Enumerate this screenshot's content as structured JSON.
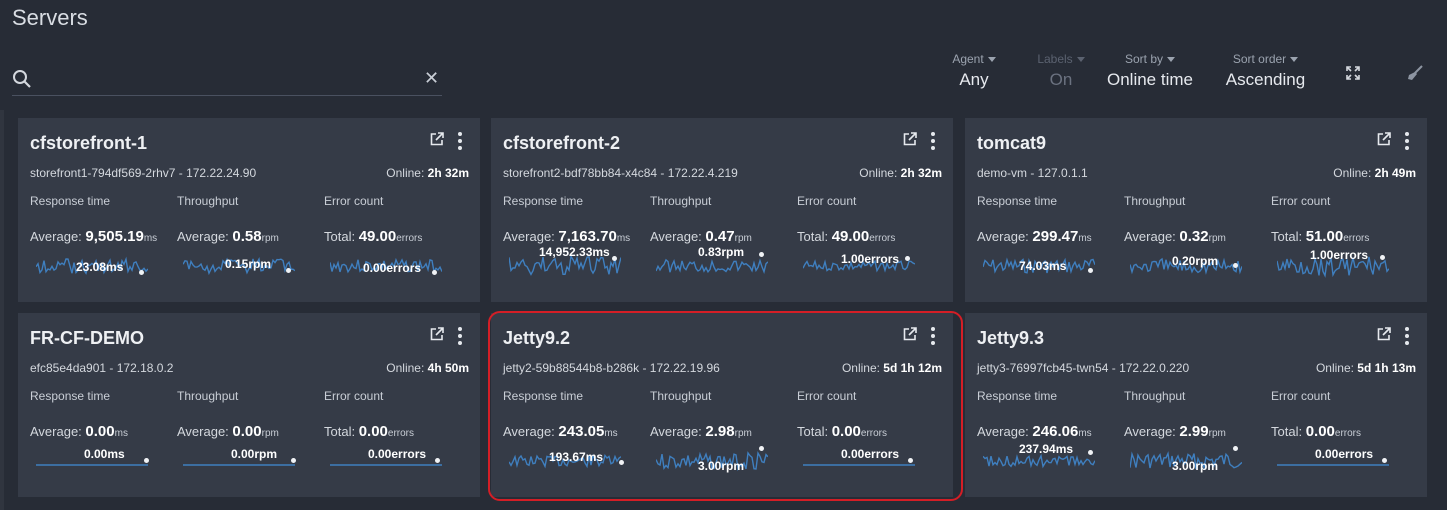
{
  "page": {
    "title": "Servers"
  },
  "search": {
    "value": "",
    "placeholder": ""
  },
  "filters": [
    {
      "label": "Agent",
      "value": "Any"
    },
    {
      "label": "Labels",
      "value": "On"
    },
    {
      "label": "Sort by",
      "value": "Online time"
    },
    {
      "label": "Sort order",
      "value": "Ascending"
    }
  ],
  "metric_headers": {
    "response": "Response time",
    "throughput": "Throughput",
    "errors": "Error count"
  },
  "metric_prefixes": {
    "response": "Average: ",
    "throughput": "Average: ",
    "errors": "Total: "
  },
  "online_prefix": "Online: ",
  "cards": [
    {
      "name": "cfstorefront-1",
      "sub": "storefront1-794df569-2rhv7 - 172.22.24.90",
      "online": "2h 32m",
      "rt_avg": "9,505.19",
      "rt_unit": "ms",
      "tp_avg": "0.58",
      "tp_unit": "rpm",
      "err_total": "49.00",
      "err_unit": "errors",
      "rt_spark": "23.08ms",
      "tp_spark": "0.15rpm",
      "err_spark": "0.00errors"
    },
    {
      "name": "cfstorefront-2",
      "sub": "storefront2-bdf78bb84-x4c84 - 172.22.4.219",
      "online": "2h 32m",
      "rt_avg": "7,163.70",
      "rt_unit": "ms",
      "tp_avg": "0.47",
      "tp_unit": "rpm",
      "err_total": "49.00",
      "err_unit": "errors",
      "rt_spark": "14,952.33ms",
      "tp_spark": "0.83rpm",
      "err_spark": "1.00errors"
    },
    {
      "name": "tomcat9",
      "sub": "demo-vm - 127.0.1.1",
      "online": "2h 49m",
      "rt_avg": "299.47",
      "rt_unit": "ms",
      "tp_avg": "0.32",
      "tp_unit": "rpm",
      "err_total": "51.00",
      "err_unit": "errors",
      "rt_spark": "74.03ms",
      "tp_spark": "0.20rpm",
      "err_spark": "1.00errors"
    },
    {
      "name": "FR-CF-DEMO",
      "sub": "efc85e4da901 - 172.18.0.2",
      "online": "4h 50m",
      "rt_avg": "0.00",
      "rt_unit": "ms",
      "tp_avg": "0.00",
      "tp_unit": "rpm",
      "err_total": "0.00",
      "err_unit": "errors",
      "rt_spark": "0.00ms",
      "tp_spark": "0.00rpm",
      "err_spark": "0.00errors"
    },
    {
      "name": "Jetty9.2",
      "sub": "jetty2-59b88544b8-b286k - 172.22.19.96",
      "online": "5d 1h 12m",
      "rt_avg": "243.05",
      "rt_unit": "ms",
      "tp_avg": "2.98",
      "tp_unit": "rpm",
      "err_total": "0.00",
      "err_unit": "errors",
      "rt_spark": "193.67ms",
      "tp_spark": "3.00rpm",
      "err_spark": "0.00errors"
    },
    {
      "name": "Jetty9.3",
      "sub": "jetty3-76997fcb45-twn54 - 172.22.0.220",
      "online": "5d 1h 13m",
      "rt_avg": "246.06",
      "rt_unit": "ms",
      "tp_avg": "2.99",
      "tp_unit": "rpm",
      "err_total": "0.00",
      "err_unit": "errors",
      "rt_spark": "237.94ms",
      "tp_spark": "3.00rpm",
      "err_spark": "0.00errors"
    }
  ],
  "colors": {
    "spark": "#3f7fbf",
    "selection": "#d41e26"
  },
  "icons": {
    "search": "search-icon",
    "clear": "close-icon",
    "expand": "expand-icon",
    "clear_filters": "broom-icon",
    "open": "external-link-icon",
    "menu": "kebab-menu-icon"
  }
}
